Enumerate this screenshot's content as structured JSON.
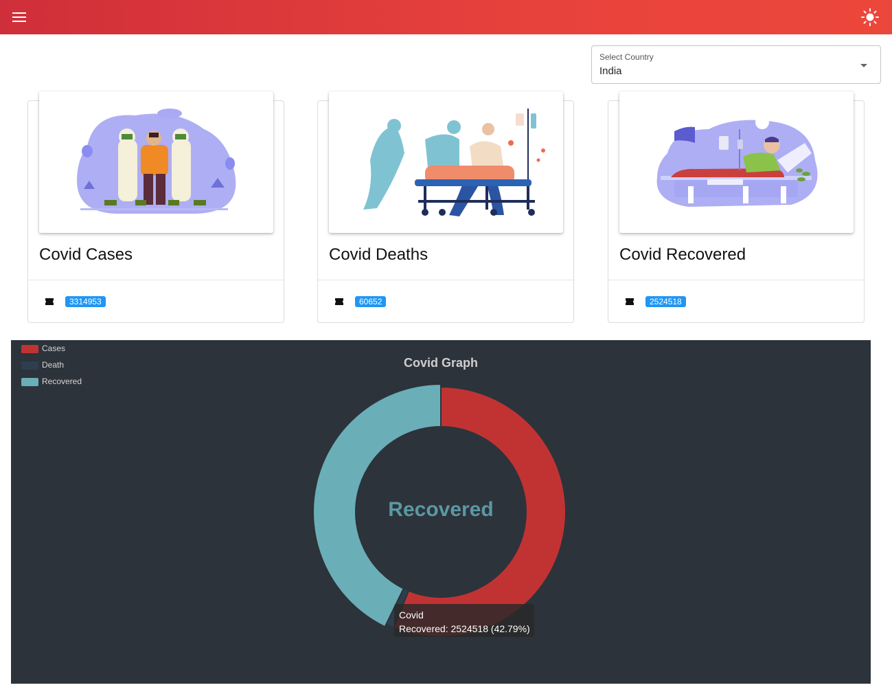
{
  "header": {
    "menu_icon": "menu-icon",
    "theme_icon": "sun-icon",
    "accent": "#e53e3e"
  },
  "country_select": {
    "label": "Select Country",
    "value": "India"
  },
  "cards": [
    {
      "title": "Covid Cases",
      "count": "3314953"
    },
    {
      "title": "Covid Deaths",
      "count": "60652"
    },
    {
      "title": "Covid Recovered",
      "count": "2524518"
    }
  ],
  "chart": {
    "center_text": "Recovered",
    "tooltip_title": "Covid",
    "tooltip_body": "Recovered: 2524518 (42.79%)"
  },
  "chart_data": {
    "type": "pie",
    "title": "Covid Graph",
    "donut": true,
    "legend_position": "top-left",
    "categories": [
      "Cases",
      "Death",
      "Recovered"
    ],
    "values": [
      3314953,
      60652,
      2524518
    ],
    "colors": [
      "#c13333",
      "#2d3e4f",
      "#6aaeb8"
    ]
  }
}
